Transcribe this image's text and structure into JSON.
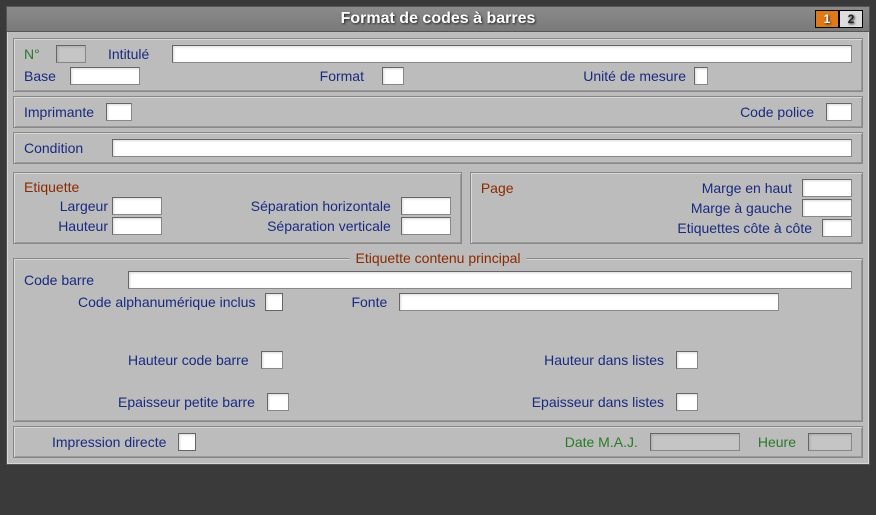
{
  "title": "Format de codes à barres",
  "pager": {
    "page1": "1",
    "page2": "2"
  },
  "top": {
    "numero_label": "N°",
    "intitule_label": "Intitulé",
    "base_label": "Base",
    "format_label": "Format",
    "unite_label": "Unité de mesure"
  },
  "printer": {
    "imprimante_label": "Imprimante",
    "code_police_label": "Code police"
  },
  "condition": {
    "label": "Condition"
  },
  "etiquette": {
    "heading": "Etiquette",
    "largeur": "Largeur",
    "hauteur": "Hauteur",
    "sep_h": "Séparation horizontale",
    "sep_v": "Séparation verticale"
  },
  "page": {
    "heading": "Page",
    "marge_haut": "Marge en haut",
    "marge_gauche": "Marge à gauche",
    "cote": "Etiquettes côte à côte"
  },
  "contenu": {
    "heading": "Etiquette contenu principal",
    "code_barre": "Code barre",
    "alpha": "Code alphanumérique inclus",
    "fonte": "Fonte",
    "hauteur_cb": "Hauteur code barre",
    "hauteur_listes": "Hauteur dans listes",
    "epaisseur_pb": "Epaisseur petite barre",
    "epaisseur_listes": "Epaisseur dans listes"
  },
  "footer": {
    "impression": "Impression directe",
    "date": "Date M.A.J.",
    "heure": "Heure"
  }
}
